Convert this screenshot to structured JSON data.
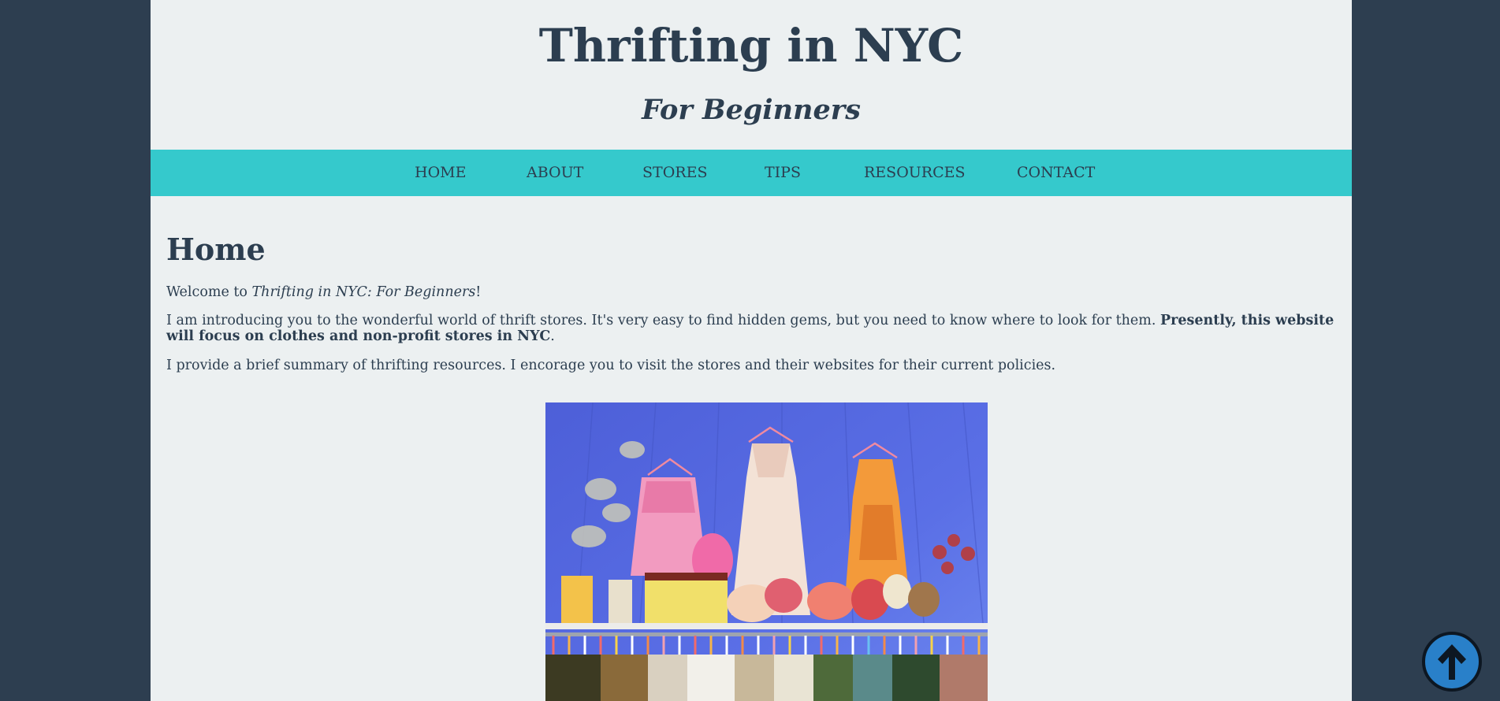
{
  "site": {
    "title": "Thrifting in NYC",
    "subtitle": "For Beginners"
  },
  "nav": {
    "items": [
      "HOME",
      "ABOUT",
      "STORES",
      "TIPS",
      "RESOURCES",
      "CONTACT"
    ]
  },
  "main": {
    "heading": "Home",
    "welcome_prefix": "Welcome to ",
    "welcome_italic": "Thrifting in NYC: For Beginners",
    "welcome_suffix": "!",
    "intro_text": "I am introducing you to the wonderful world of thrift stores. It's very easy to find hidden gems, but you need to know where to look for them. ",
    "intro_bold": "Presently, this website will focus on clothes and non-profit stores in NYC",
    "intro_end": ".",
    "summary": "I provide a brief summary of thrifting resources. I encorage you to visit the stores and their websites for their current policies."
  },
  "icons": {
    "back_to_top": "arrow-up-icon"
  },
  "colors": {
    "background": "#2d3e50",
    "page": "#ecf0f1",
    "nav": "#35c9cc",
    "text": "#2c3e50",
    "back_to_top": "#2980c9"
  }
}
